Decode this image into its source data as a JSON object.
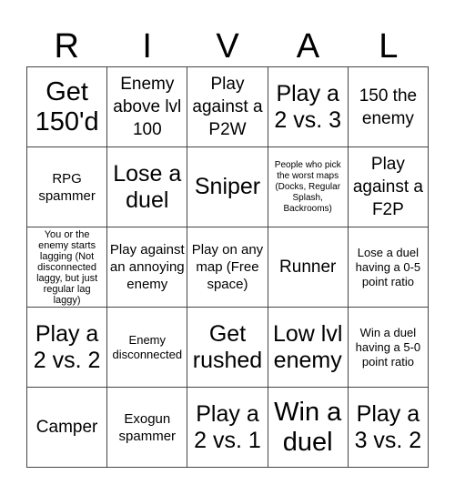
{
  "title_letters": [
    "R",
    "I",
    "V",
    "A",
    "L"
  ],
  "cells": [
    [
      "Get 150'd",
      "Enemy above lvl 100",
      "Play against a P2W",
      "Play a 2 vs. 3",
      "150 the enemy"
    ],
    [
      "RPG spammer",
      "Lose a duel",
      "Sniper",
      "People who pick the worst maps (Docks, Regular Splash, Backrooms)",
      "Play against a F2P"
    ],
    [
      "You or the enemy starts lagging (Not disconnected laggy, but just regular lag laggy)",
      "Play against an annoying enemy",
      "Play on any map (Free space)",
      "Runner",
      "Lose a duel having a 0-5 point ratio"
    ],
    [
      "Play a 2 vs. 2",
      "Enemy disconnected",
      "Get rushed",
      "Low lvl enemy",
      "Win a duel having a 5-0 point ratio"
    ],
    [
      "Camper",
      "Exogun spammer",
      "Play a 2 vs. 1",
      "Win a duel",
      "Play a 3 vs. 2"
    ]
  ]
}
